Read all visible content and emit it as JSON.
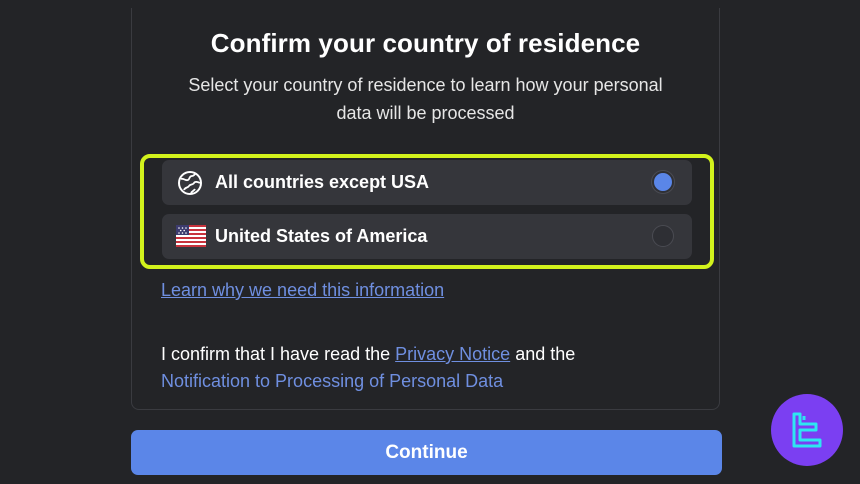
{
  "dialog": {
    "title": "Confirm your country of residence",
    "subtitle": "Select your country of residence to learn how your personal data will be processed"
  },
  "options": [
    {
      "label": "All countries except USA",
      "icon": "globe-icon",
      "selected": true
    },
    {
      "label": "United States of America",
      "icon": "us-flag-icon",
      "selected": false
    }
  ],
  "learn_link": "Learn why we need this information",
  "consent": {
    "prefix": "I confirm that I have read the",
    "privacy_link": "Privacy Notice",
    "middle": "and the",
    "notification_link": "Notification to Processing of Personal Data"
  },
  "continue_label": "Continue",
  "colors": {
    "background": "#232427",
    "option_bg": "#35363b",
    "accent": "#5b86e8",
    "link": "#6f8fe0",
    "highlight": "#d2f21c",
    "logo": "#7b3ff2"
  },
  "watermark": {
    "icon": "tradingfinder-logo-icon"
  }
}
